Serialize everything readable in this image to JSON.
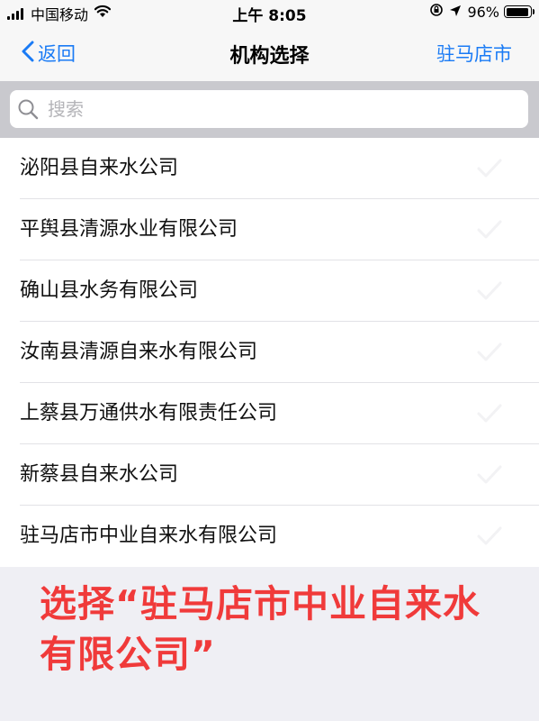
{
  "status_bar": {
    "carrier": "中国移动",
    "time": "上午 8:05",
    "battery_percent": "96%",
    "battery_level": 0.96,
    "icons": [
      "signal-icon",
      "wifi-icon",
      "orientation-lock-icon",
      "location-arrow-icon",
      "battery-icon"
    ]
  },
  "nav": {
    "back_label": "返回",
    "title": "机构选择",
    "right_label": "驻马店市"
  },
  "search": {
    "placeholder": "搜索",
    "value": ""
  },
  "list": {
    "items": [
      {
        "label": "泌阳县自来水公司"
      },
      {
        "label": "平舆县清源水业有限公司"
      },
      {
        "label": "确山县水务有限公司"
      },
      {
        "label": "汝南县清源自来水有限公司"
      },
      {
        "label": "上蔡县万通供水有限责任公司"
      },
      {
        "label": "新蔡县自来水公司"
      },
      {
        "label": "驻马店市中业自来水有限公司"
      }
    ]
  },
  "annotation": {
    "text": "选择“驻马店市中业自来水有限公司”"
  },
  "colors": {
    "accent": "#1a7bf5",
    "annotation": "#f03a3a",
    "search_bg": "#c9c9ce"
  }
}
